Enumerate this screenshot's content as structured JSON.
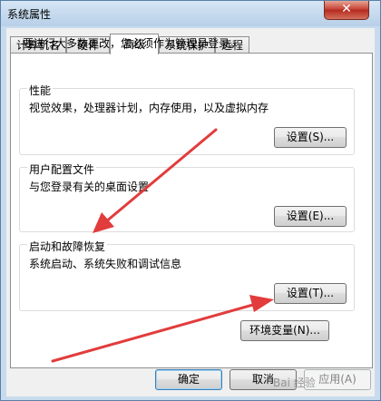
{
  "window": {
    "title": "系统属性",
    "close_glyph": "✕"
  },
  "tabs": [
    {
      "label": "计算机名",
      "active": false
    },
    {
      "label": "硬件",
      "active": false
    },
    {
      "label": "高级",
      "active": true
    },
    {
      "label": "系统保护",
      "active": false
    },
    {
      "label": "远程",
      "active": false
    }
  ],
  "advanced": {
    "notice": "要进行大多数更改，您必须作为管理员登录。",
    "performance": {
      "title": "性能",
      "description": "视觉效果，处理器计划，内存使用，以及虚拟内存",
      "button": "设置(S)..."
    },
    "user_profiles": {
      "title": "用户配置文件",
      "description": "与您登录有关的桌面设置",
      "button": "设置(E)..."
    },
    "startup_recovery": {
      "title": "启动和故障恢复",
      "description": "系统启动、系统失败和调试信息",
      "button": "设置(T)..."
    },
    "env_button": "环境变量(N)..."
  },
  "footer": {
    "ok": "确定",
    "cancel": "取消",
    "apply": "应用(A)"
  },
  "watermark": "Bai 经验",
  "colors": {
    "annotation_arrow": "#e23c3c",
    "close_button": "#c7453a"
  },
  "icons": [
    "close-icon"
  ]
}
